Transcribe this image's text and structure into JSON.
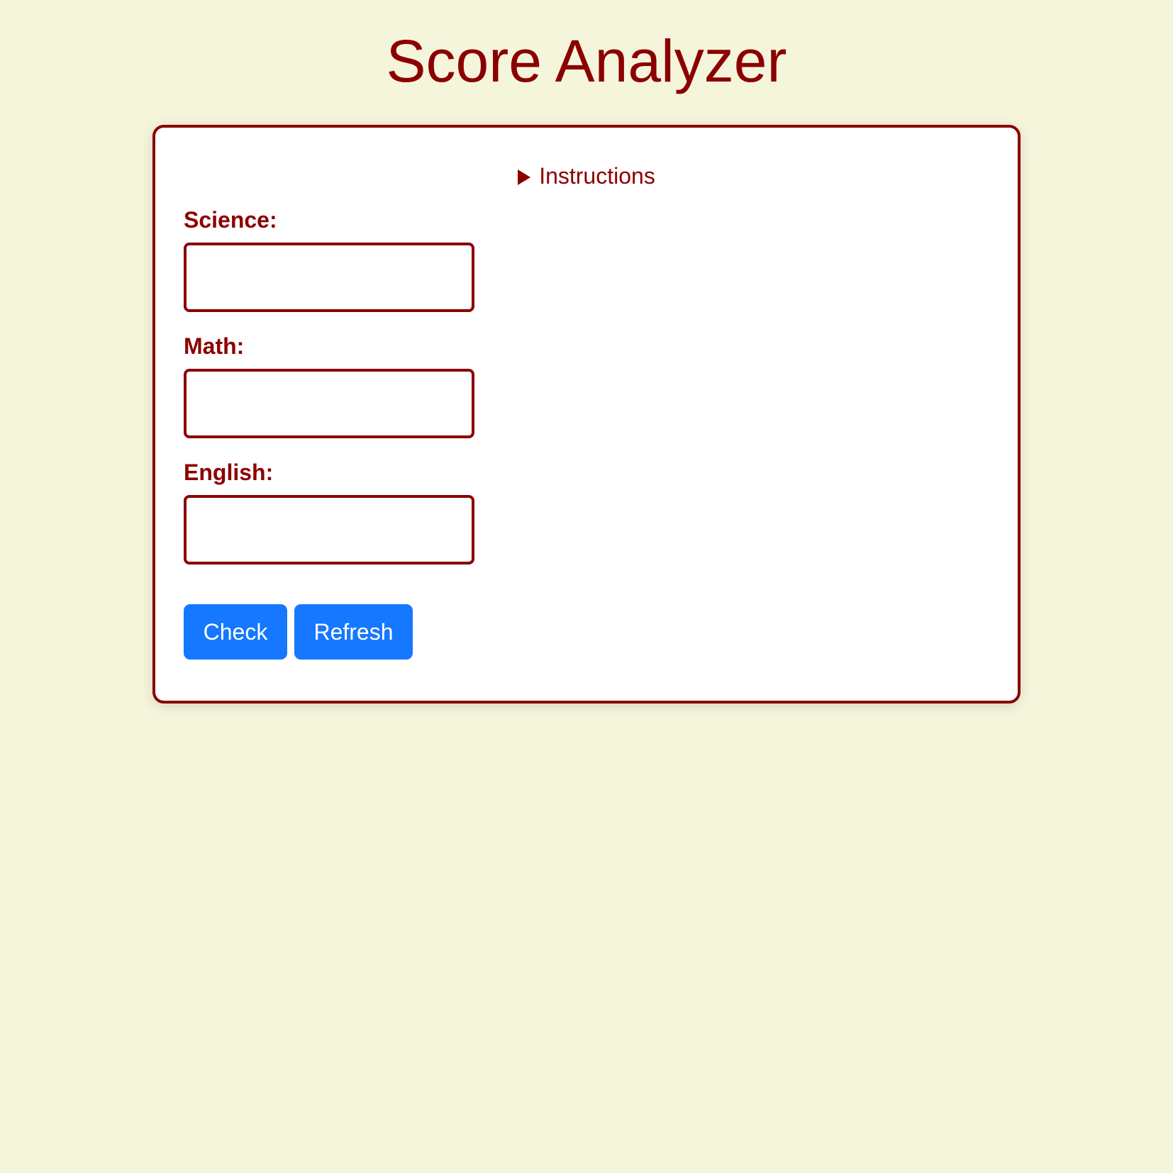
{
  "header": {
    "title": "Score Analyzer"
  },
  "instructions": {
    "label": "Instructions",
    "expanded": false
  },
  "form": {
    "fields": [
      {
        "label": "Science:",
        "value": "",
        "placeholder": ""
      },
      {
        "label": "Math:",
        "value": "",
        "placeholder": ""
      },
      {
        "label": "English:",
        "value": "",
        "placeholder": ""
      }
    ],
    "buttons": {
      "check_label": "Check",
      "refresh_label": "Refresh"
    }
  },
  "colors": {
    "background": "#f5f5dc",
    "accent": "#8b0000",
    "button": "#1677ff"
  },
  "icons": {
    "instructions_toggle": "triangle-right-icon"
  }
}
